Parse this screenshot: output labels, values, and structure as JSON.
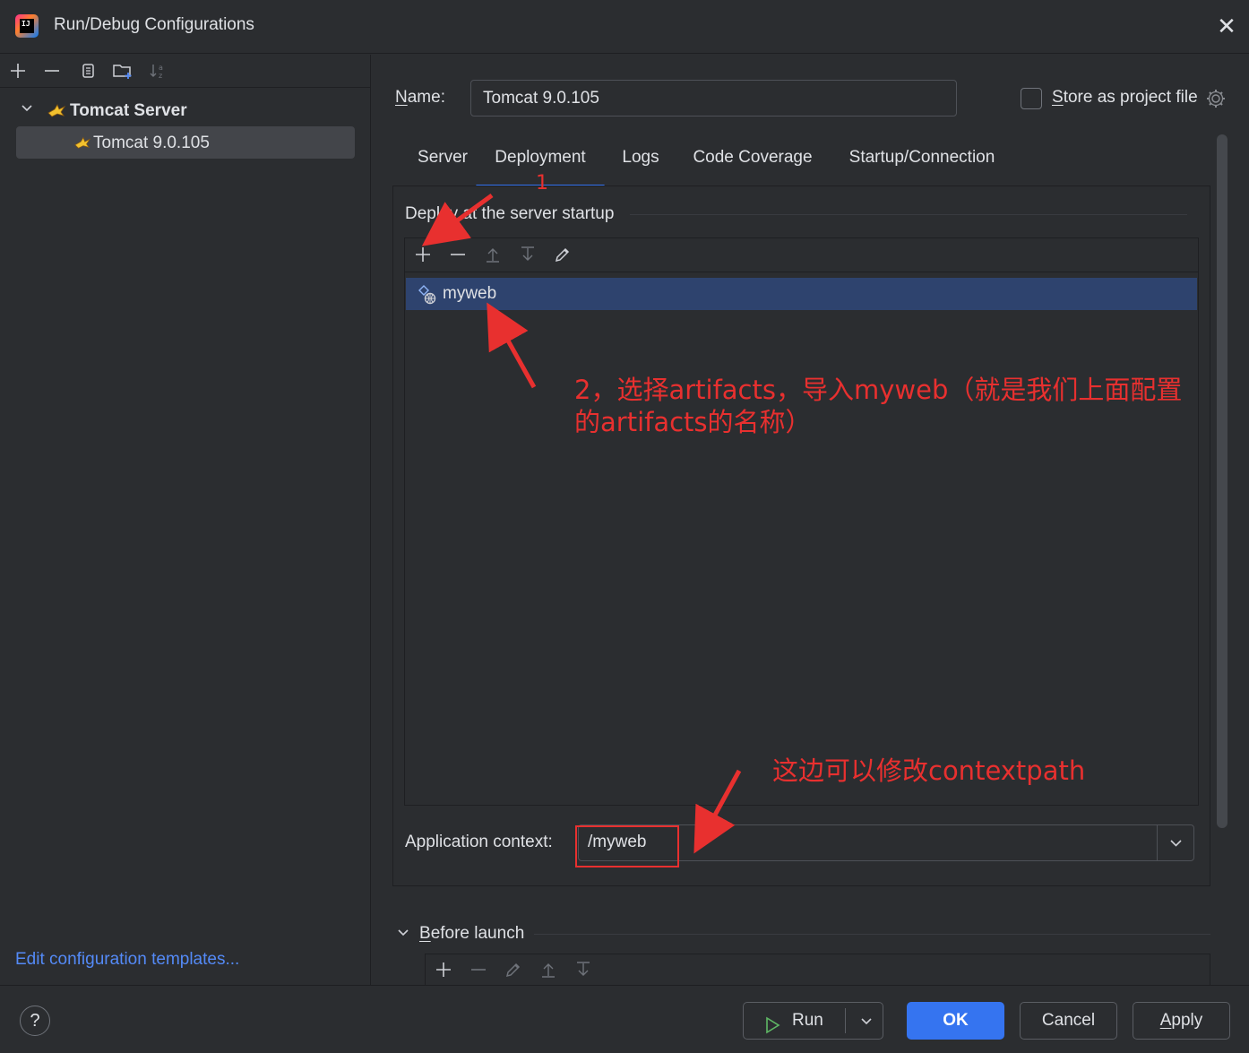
{
  "window": {
    "title": "Run/Debug Configurations",
    "close_icon": "close-icon"
  },
  "left_toolbar": {
    "icons": [
      "add-icon",
      "remove-icon",
      "copy-icon",
      "folder-add-icon",
      "sort-alpha-icon"
    ]
  },
  "tree": {
    "group_label": "Tomcat Server",
    "item_label": "Tomcat 9.0.105"
  },
  "edit_templates_link": "Edit configuration templates...",
  "name": {
    "label_mnemonic": "N",
    "label_rest": "ame:",
    "value": "Tomcat 9.0.105"
  },
  "store_as_project": {
    "label_mnemonic": "S",
    "label_rest": "tore as project file",
    "checked": false
  },
  "tabs": [
    {
      "label": "Server",
      "active": false
    },
    {
      "label": "Deployment",
      "active": true
    },
    {
      "label": "Logs",
      "active": false
    },
    {
      "label": "Code Coverage",
      "active": false
    },
    {
      "label": "Startup/Connection",
      "active": false
    }
  ],
  "deployment": {
    "section_title": "Deploy at the server startup",
    "toolbar_icons": [
      "add-icon",
      "remove-icon",
      "move-up-icon",
      "move-down-icon",
      "edit-icon"
    ],
    "artifacts": [
      "myweb"
    ],
    "application_context_label": "Application context:",
    "application_context_value": "/myweb"
  },
  "before_launch": {
    "label_mnemonic": "B",
    "label_rest": "efore launch",
    "toolbar_icons": [
      "add-icon",
      "remove-icon",
      "edit-icon",
      "move-up-icon",
      "move-down-icon"
    ]
  },
  "footer": {
    "help": "?",
    "run_label": "Run",
    "ok_label": "OK",
    "cancel_label": "Cancel",
    "apply_mnemonic": "A",
    "apply_rest": "pply"
  },
  "annotations": {
    "step1": "1",
    "step2": "2，选择artifacts，导入myweb（就是我们上面配置的artifacts的名称）",
    "context_note": "这边可以修改contextpath",
    "color": "#e8302f"
  },
  "colors": {
    "accent": "#3574f0",
    "background": "#2b2d30",
    "selection": "#2e436e",
    "link": "#548af7"
  }
}
